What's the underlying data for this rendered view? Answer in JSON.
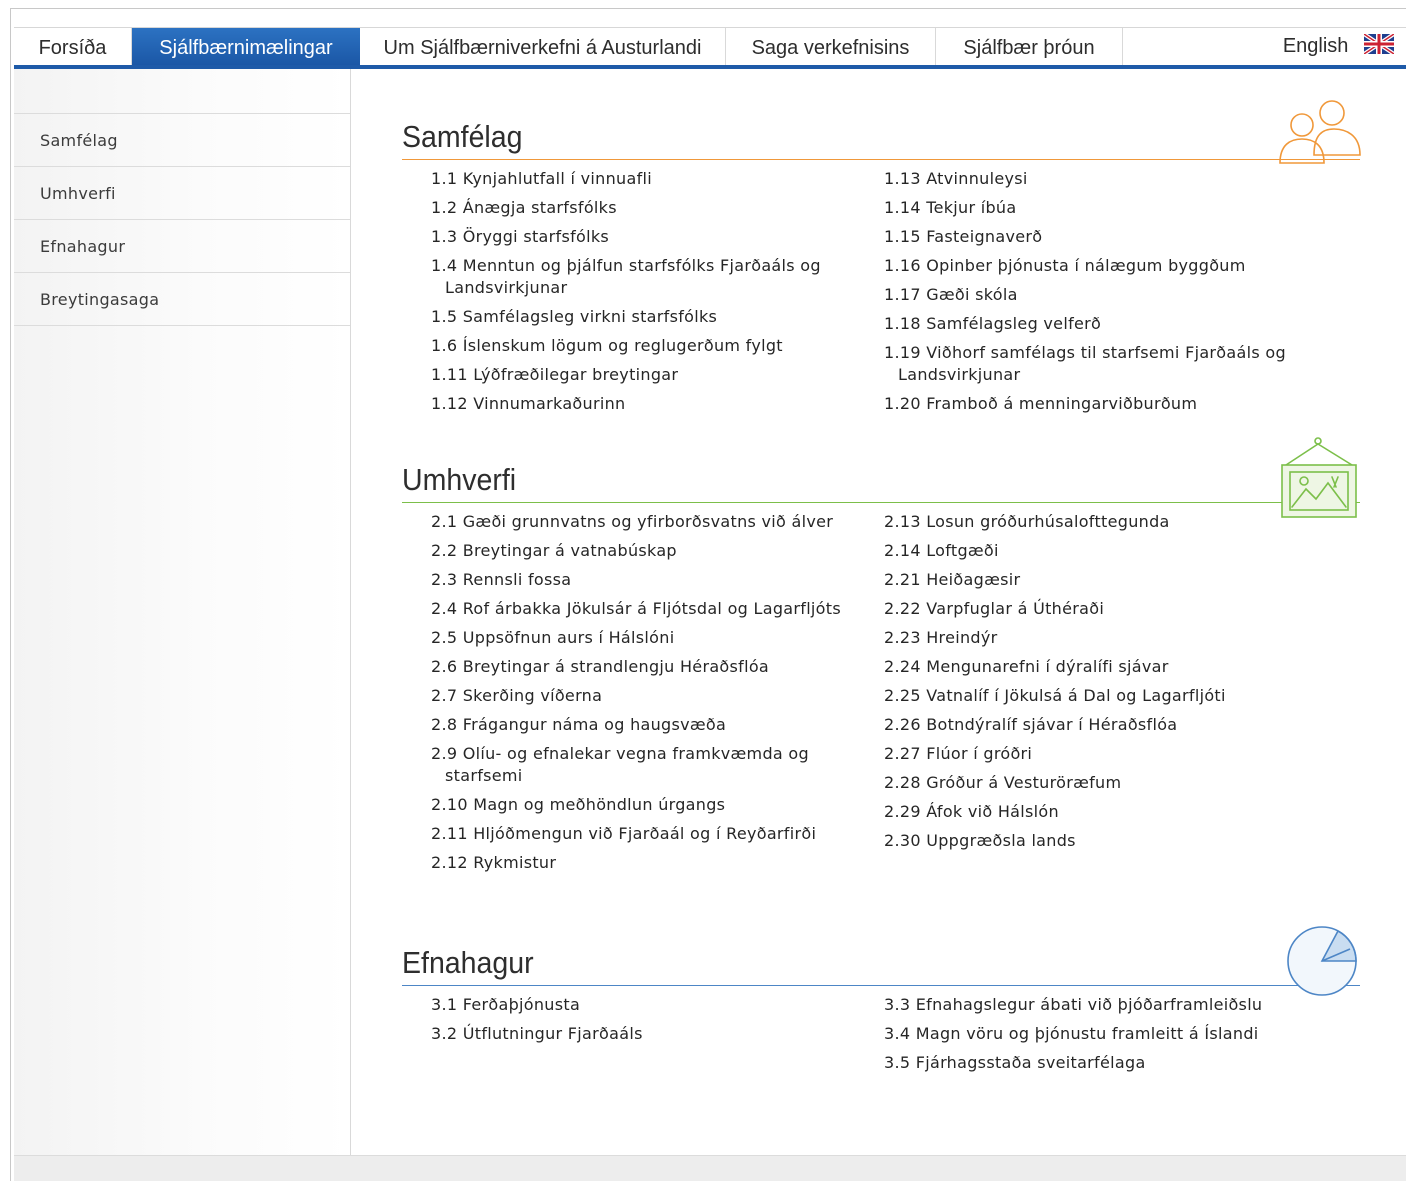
{
  "nav": {
    "items": [
      {
        "label": "Forsíða"
      },
      {
        "label": "Sjálfbærnimælingar"
      },
      {
        "label": "Um Sjálfbærniverkefni á Austurlandi"
      },
      {
        "label": "Saga verkefnisins"
      },
      {
        "label": "Sjálfbær þróun"
      }
    ],
    "active_index": 1,
    "language": "English"
  },
  "sidebar": {
    "items": [
      {
        "label": "Samfélag"
      },
      {
        "label": "Umhverfi"
      },
      {
        "label": "Efnahagur"
      },
      {
        "label": "Breytingasaga"
      }
    ]
  },
  "sections": [
    {
      "title": "Samfélag",
      "icon": "people-icon",
      "color": "#f0983a",
      "left": [
        "1.1 Kynjahlutfall í vinnuafli",
        "1.2 Ánægja starfsfólks",
        "1.3 Öryggi starfsfólks",
        "1.4 Menntun og þjálfun starfsfólks Fjarðaáls og Landsvirkjunar",
        "1.5 Samfélagsleg virkni starfsfólks",
        "1.6 Íslenskum lögum og reglugerðum fylgt",
        "1.11 Lýðfræðilegar breytingar",
        "1.12 Vinnumarkaðurinn"
      ],
      "right": [
        "1.13 Atvinnuleysi",
        "1.14 Tekjur íbúa",
        "1.15 Fasteignaverð",
        "1.16 Opinber þjónusta í nálægum byggðum",
        "1.17 Gæði skóla",
        "1.18 Samfélagsleg velferð",
        "1.19 Viðhorf samfélags til starfsemi Fjarðaáls og Landsvirkjunar",
        "1.20 Framboð á menningarviðburðum"
      ]
    },
    {
      "title": "Umhverfi",
      "icon": "landscape-picture-icon",
      "color": "#7cbf4a",
      "left": [
        "2.1 Gæði grunnvatns og yfirborðsvatns við álver",
        "2.2 Breytingar á vatnabúskap",
        "2.3 Rennsli fossa",
        "2.4 Rof árbakka Jökulsár á Fljótsdal og Lagarfljóts",
        "2.5 Uppsöfnun aurs í Hálslóni",
        "2.6 Breytingar á strandlengju Héraðsflóa",
        "2.7 Skerðing víðerna",
        "2.8 Frágangur náma og haugsvæða",
        "2.9 Olíu- og efnalekar vegna framkvæmda og starfsemi",
        "2.10 Magn og meðhöndlun úrgangs",
        "2.11 Hljóðmengun við Fjarðaál og í Reyðarfirði",
        "2.12 Rykmistur"
      ],
      "right": [
        "2.13 Losun gróðurhúsalofttegunda",
        "2.14 Loftgæði",
        "2.21 Heiðagæsir",
        "2.22 Varpfuglar á Úthéraði",
        "2.23 Hreindýr",
        "2.24 Mengunarefni í dýralífi sjávar",
        "2.25 Vatnalíf í Jökulsá á Dal og Lagarfljóti",
        "2.26 Botndýralíf sjávar í Héraðsflóa",
        "2.27 Flúor í gróðri",
        "2.28 Gróður á Vesturöræfum",
        "2.29 Áfok við Hálslón",
        "2.30 Uppgræðsla lands"
      ]
    },
    {
      "title": "Efnahagur",
      "icon": "pie-chart-icon",
      "color": "#4d86c6",
      "left": [
        "3.1 Ferðaþjónusta",
        "3.2 Útflutningur Fjarðaáls"
      ],
      "right": [
        "3.3 Efnahagslegur ábati við þjóðarframleiðslu",
        "3.4 Magn vöru og þjónustu framleitt á Íslandi",
        "3.5 Fjárhagsstaða sveitarfélaga"
      ]
    }
  ]
}
